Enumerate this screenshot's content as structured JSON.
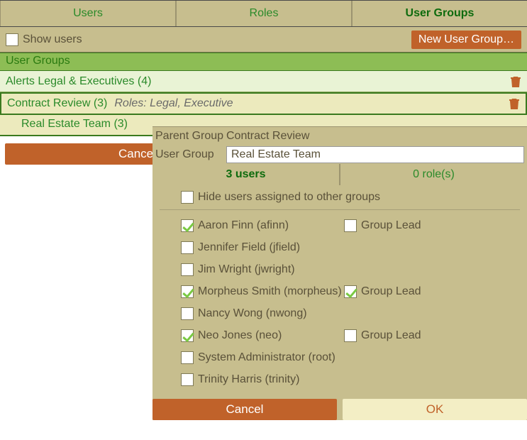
{
  "tabs": [
    "Users",
    "Roles",
    "User Groups"
  ],
  "active_tab": 2,
  "show_users_label": "Show users",
  "show_users_checked": false,
  "new_group_btn": "New User Group…",
  "section_title": "User Groups",
  "groups": [
    {
      "name": "Alerts Legal & Executives (4)",
      "roles": ""
    },
    {
      "name": "Contract Review (3)",
      "roles": "Roles: Legal, Executive",
      "selected": true,
      "children": [
        {
          "name": "Real Estate Team (3)"
        }
      ]
    }
  ],
  "wide_cancel": "Cancel",
  "popup": {
    "parent_label": "Parent Group",
    "parent_value": "Contract Review",
    "group_label": "User Group",
    "group_value": "Real Estate Team",
    "users_summary": "3 users",
    "roles_summary": "0 role(s)",
    "hide_label": "Hide users assigned to other groups",
    "hide_checked": false,
    "users": [
      {
        "name": "Aaron Finn (afinn)",
        "checked": true,
        "lead_label": "Group Lead",
        "lead_checked": false
      },
      {
        "name": "Jennifer Field (jfield)",
        "checked": false,
        "lead_label": "",
        "lead_checked": false
      },
      {
        "name": "Jim Wright (jwright)",
        "checked": false,
        "lead_label": "",
        "lead_checked": false
      },
      {
        "name": "Morpheus Smith (morpheus)",
        "checked": true,
        "lead_label": "Group Lead",
        "lead_checked": true
      },
      {
        "name": "Nancy Wong (nwong)",
        "checked": false,
        "lead_label": "",
        "lead_checked": false
      },
      {
        "name": "Neo Jones (neo)",
        "checked": true,
        "lead_label": "Group Lead",
        "lead_checked": false
      },
      {
        "name": "System Administrator (root)",
        "checked": false,
        "lead_label": "",
        "lead_checked": false
      },
      {
        "name": "Trinity Harris (trinity)",
        "checked": false,
        "lead_label": "",
        "lead_checked": false
      }
    ],
    "cancel": "Cancel",
    "ok": "OK"
  }
}
